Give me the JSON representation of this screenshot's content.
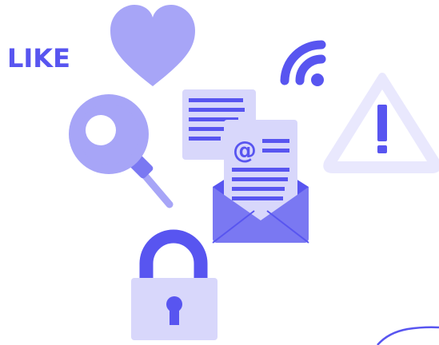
{
  "like_label": "LIKE",
  "colors": {
    "primary": "#5855f0",
    "mid": "#7a78f2",
    "light": "#a7a5f7",
    "pale": "#d8d7fb",
    "paler": "#e9e8fd"
  },
  "icons": [
    "heart-icon",
    "wifi-icon",
    "magnifier-icon",
    "document-icon",
    "email-icon",
    "envelope-icon",
    "warning-icon",
    "padlock-icon"
  ]
}
